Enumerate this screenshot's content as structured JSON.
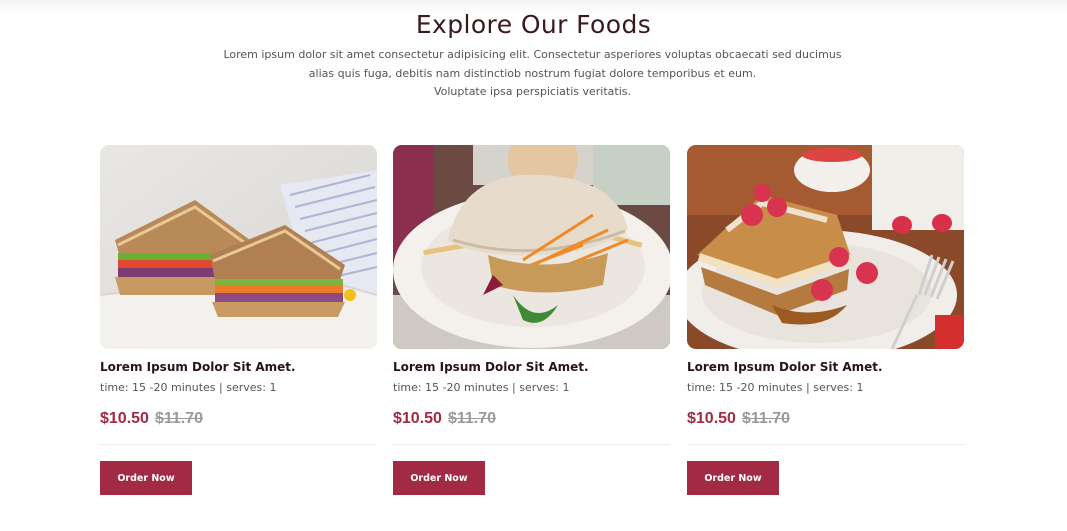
{
  "section": {
    "title": "Explore Our Foods",
    "description_lines": [
      "Lorem ipsum dolor sit amet consectetur adipisicing elit. Consectetur asperiores voluptas obcaecati sed ducimus",
      "alias quis fuga, debitis nam distinctiob nostrum fugiat dolore temporibus et eum.",
      "Voluptate ipsa perspiciatis veritatis."
    ]
  },
  "foods": [
    {
      "image": "sandwich-photo",
      "name": "Lorem Ipsum Dolor Sit Amet.",
      "meta": "time: 15 -20 minutes | serves: 1",
      "price": "$10.50",
      "old_price": "$11.70",
      "button_label": "Order Now"
    },
    {
      "image": "burger-photo",
      "name": "Lorem Ipsum Dolor Sit Amet.",
      "meta": "time: 15 -20 minutes | serves: 1",
      "price": "$10.50",
      "old_price": "$11.70",
      "button_label": "Order Now"
    },
    {
      "image": "french-toast-photo",
      "name": "Lorem Ipsum Dolor Sit Amet.",
      "meta": "time: 15 -20 minutes | serves: 1",
      "price": "$10.50",
      "old_price": "$11.70",
      "button_label": "Order Now"
    }
  ],
  "colors": {
    "accent": "#a32a45",
    "title": "#3a1a1e",
    "muted": "#9a9a9a"
  }
}
